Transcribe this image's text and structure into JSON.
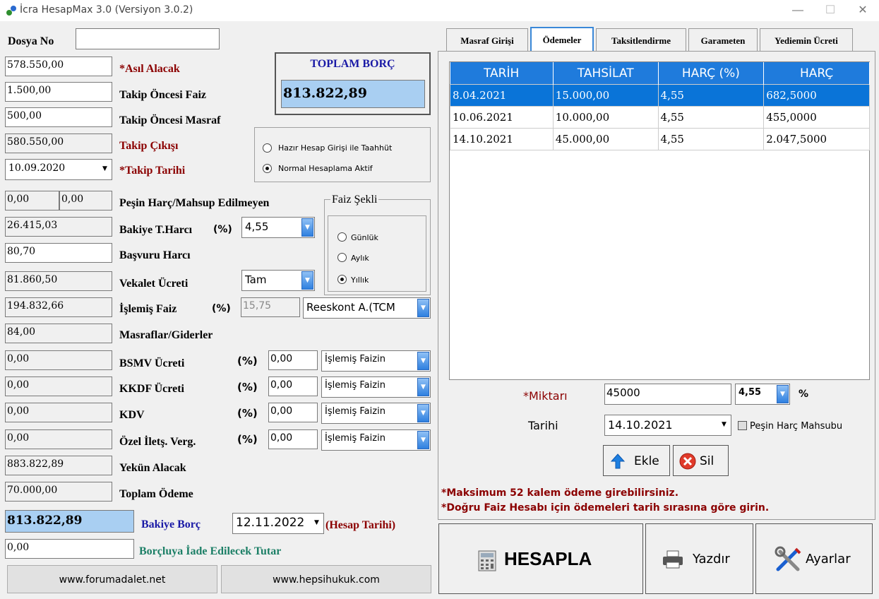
{
  "window": {
    "title": "İcra HesapMax 3.0 (Versiyon 3.0.2)",
    "min": "—",
    "max": "☐",
    "close": "✕"
  },
  "left": {
    "dosya_no_label": "Dosya No",
    "dosya_no_value": "",
    "asil_alacak": {
      "value": "578.550,00",
      "label": "*Asıl Alacak"
    },
    "takip_oncesi_faiz": {
      "value": "1.500,00",
      "label": "Takip Öncesi Faiz"
    },
    "takip_oncesi_masraf": {
      "value": "500,00",
      "label": "Takip Öncesi Masraf"
    },
    "takip_cikisi": {
      "value": "580.550,00",
      "label": "Takip Çıkışı"
    },
    "takip_tarihi": {
      "value": "10.09.2020",
      "label": "*Takip Tarihi"
    },
    "toplam_borc": {
      "label": "TOPLAM BORÇ",
      "value": "813.822,89"
    },
    "hesap_mode": {
      "option1": "Hazır Hesap Girişi ile Taahhüt",
      "option2": "Normal Hesaplama Aktif"
    },
    "pesin_harc": {
      "value1": "0,00",
      "value2": "0,00",
      "label": "Peşin Harç/Mahsup Edilmeyen"
    },
    "bakiye_tharci": {
      "value": "26.415,03",
      "label": "Bakiye T.Harcı",
      "pct": "(%)",
      "rate": "4,55"
    },
    "basvuru_harci": {
      "value": "80,70",
      "label": "Başvuru Harcı"
    },
    "vekalet_ucreti": {
      "value": "81.860,50",
      "label": "Vekalet Ücreti",
      "type": "Tam"
    },
    "faiz_sekli": {
      "label": "Faiz Şekli",
      "gunluk": "Günlük",
      "aylik": "Aylık",
      "yillik": "Yıllık"
    },
    "islemis_faiz": {
      "value": "194.832,66",
      "label": "İşlemiş Faiz",
      "pct": "(%)",
      "rate": "15,75",
      "type": "Reeskont A.(TCM"
    },
    "masraflar": {
      "value": "84,00",
      "label": "Masraflar/Giderler"
    },
    "bsmv": {
      "value": "0,00",
      "label": "BSMV Ücreti",
      "pct": "(%)",
      "rate": "0,00",
      "base": "İşlemiş Faizin"
    },
    "kkdf": {
      "value": "0,00",
      "label": "KKDF Ücreti",
      "pct": "(%)",
      "rate": "0,00",
      "base": "İşlemiş Faizin"
    },
    "kdv": {
      "value": "0,00",
      "label": "KDV",
      "pct": "(%)",
      "rate": "0,00",
      "base": "İşlemiş Faizin"
    },
    "ozel_iletisim": {
      "value": "0,00",
      "label": "Özel İletş. Verg.",
      "pct": "(%)",
      "rate": "0,00",
      "base": "İşlemiş Faizin"
    },
    "yekun_alacak": {
      "value": "883.822,89",
      "label": "Yekün Alacak"
    },
    "toplam_odeme": {
      "value": "70.000,00",
      "label": "Toplam Ödeme"
    },
    "bakiye_borc": {
      "value": "813.822,89",
      "label": "Bakiye Borç",
      "date": "12.11.2022",
      "date_label": "(Hesap Tarihi)"
    },
    "iade": {
      "value": "0,00",
      "label": "Borçluya İade Edilecek Tutar"
    },
    "link1": "www.forumadalet.net",
    "link2": "www.hepsihukuk.com"
  },
  "tabs": [
    "Masraf Girişi",
    "Ödemeler",
    "Taksitlendirme",
    "Garameten",
    "Yediemin Ücreti"
  ],
  "payments": {
    "headers": [
      "TARİH",
      "TAHSİLAT",
      "HARÇ (%)",
      "HARÇ"
    ],
    "rows": [
      [
        "8.04.2021",
        "15.000,00",
        "4,55",
        "682,5000"
      ],
      [
        "10.06.2021",
        "10.000,00",
        "4,55",
        "455,0000"
      ],
      [
        "14.10.2021",
        "45.000,00",
        "4,55",
        "2.047,5000"
      ]
    ],
    "miktar_label": "*Miktarı",
    "miktar_value": "45000",
    "rate_value": "4,55",
    "pct_sign": "%",
    "tarih_label": "Tarihi",
    "tarih_value": "14.10.2021",
    "pesin_check_label": "Peşin Harç Mahsubu",
    "ekle_label": "Ekle",
    "sil_label": "Sil",
    "note1": "*Maksimum 52 kalem ödeme girebilirsiniz.",
    "note2": "*Doğru Faiz Hesabı için ödemeleri tarih sırasına göre girin."
  },
  "actions": {
    "hesapla": "HESAPLA",
    "yazdir": "Yazdır",
    "ayarlar": "Ayarlar"
  }
}
